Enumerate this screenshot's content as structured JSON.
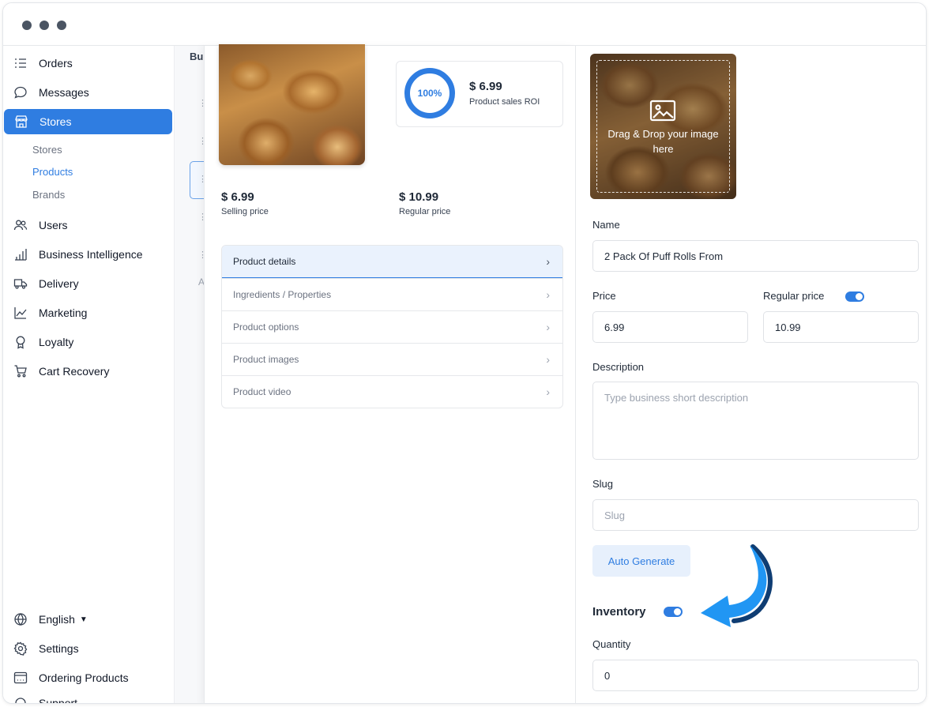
{
  "sidebar": {
    "items": [
      {
        "label": "Orders",
        "icon": "orders-list-icon"
      },
      {
        "label": "Messages",
        "icon": "chat-bubble-icon"
      },
      {
        "label": "Stores",
        "icon": "store-icon"
      },
      {
        "label": "Users",
        "icon": "users-icon"
      },
      {
        "label": "Business Intelligence",
        "icon": "bar-chart-icon"
      },
      {
        "label": "Delivery",
        "icon": "truck-icon"
      },
      {
        "label": "Marketing",
        "icon": "line-chart-icon"
      },
      {
        "label": "Loyalty",
        "icon": "award-icon"
      },
      {
        "label": "Cart Recovery",
        "icon": "cart-icon"
      }
    ],
    "stores_sub": [
      "Stores",
      "Products",
      "Brands"
    ],
    "active_item": "Stores",
    "active_sub": "Products",
    "bottom": [
      {
        "label": "English",
        "icon": "globe-icon"
      },
      {
        "label": "Settings",
        "icon": "gear-icon"
      },
      {
        "label": "Ordering Products",
        "icon": "calendar-icon"
      },
      {
        "label": "Support",
        "icon": "headset-icon"
      }
    ]
  },
  "background_list": {
    "header": "Bu",
    "row_letter": "A"
  },
  "product": {
    "roi_percent": "100%",
    "roi_price": "$ 6.99",
    "roi_label": "Product sales ROI",
    "selling_price": "$ 6.99",
    "selling_label": "Selling price",
    "regular_price": "$ 10.99",
    "regular_label": "Regular price"
  },
  "accordion": [
    {
      "label": "Product details",
      "active": true
    },
    {
      "label": "Ingredients / Properties",
      "active": false
    },
    {
      "label": "Product options",
      "active": false
    },
    {
      "label": "Product images",
      "active": false
    },
    {
      "label": "Product video",
      "active": false
    }
  ],
  "form": {
    "upload_text": "Drag & Drop your image here",
    "name_label": "Name",
    "name_value": "2 Pack Of Puff Rolls From",
    "price_label": "Price",
    "price_value": "6.99",
    "regular_label": "Regular price",
    "regular_value": "10.99",
    "regular_enabled": true,
    "description_label": "Description",
    "description_placeholder": "Type business short description",
    "slug_label": "Slug",
    "slug_placeholder": "Slug",
    "auto_generate": "Auto Generate",
    "inventory_label": "Inventory",
    "inventory_enabled": true,
    "quantity_label": "Quantity",
    "quantity_value": "0"
  },
  "colors": {
    "accent": "#2f7de1",
    "arrow": "#2196f3",
    "arrow_dark": "#0f3d73"
  }
}
